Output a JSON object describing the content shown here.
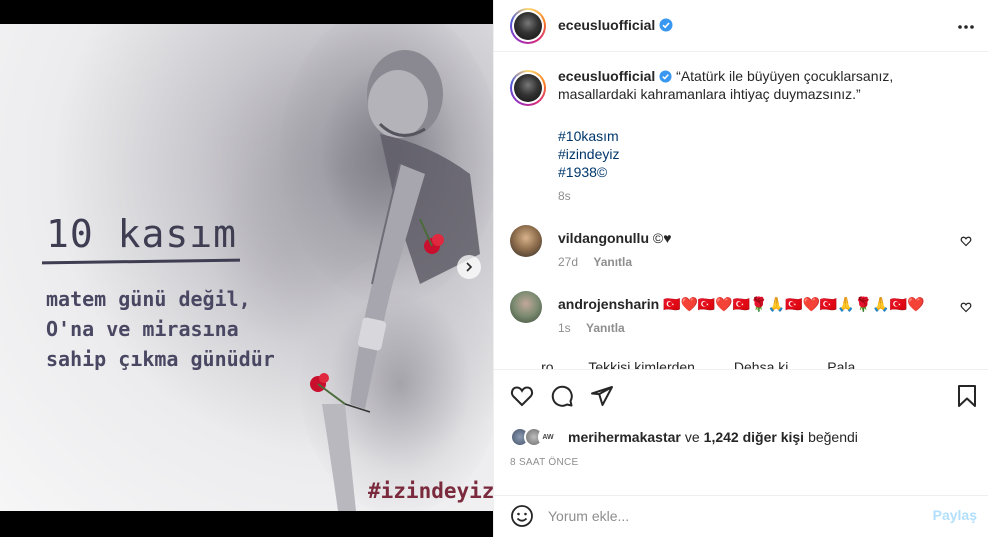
{
  "post_image": {
    "title": "10 kasım",
    "lines": [
      "matem günü değil,",
      "O'na ve mirasına",
      "sahip çıkma günüdür"
    ],
    "tag": "#izindeyiz"
  },
  "header": {
    "username": "eceusluofficial",
    "more_icon": "more-horizontal-icon"
  },
  "caption": {
    "username": "eceusluofficial",
    "text": "“Atatürk ile büyüyen çocuklarsanız, masallardaki kahramanlara ihtiyaç duymazsınız.”",
    "hashtags": [
      "#10kasım",
      "#izindeyiz",
      "#1938©"
    ],
    "time": "8s"
  },
  "comments": [
    {
      "username": "vildangonullu",
      "text": "©♥",
      "time": "27d",
      "reply": "Yanıtla"
    },
    {
      "username": "androjensharin",
      "text": "🇹🇷❤️🇹🇷❤️🇹🇷🌹🙏🇹🇷❤️🇹🇷🙏🌹🙏🇹🇷❤️",
      "time": "1s",
      "reply": "Yanıtla"
    }
  ],
  "peek_comment": "____ro____ Tekkisi kimlerden ____ Dehsa ki ____ Pala____",
  "likes": {
    "liker": "merihermakastar",
    "connector": "ve",
    "others": "1,242 diğer kişi",
    "suffix": "beğendi"
  },
  "time_ago": "8 SAAT ÖNCE",
  "add_comment": {
    "placeholder": "Yorum ekle...",
    "post_label": "Paylaş"
  },
  "colors": {
    "link": "#00376b",
    "verified": "#3897f0",
    "post_disabled": "#b2dffc",
    "muted": "#8e8e8e",
    "poster_tag": "#7a2a3c"
  }
}
